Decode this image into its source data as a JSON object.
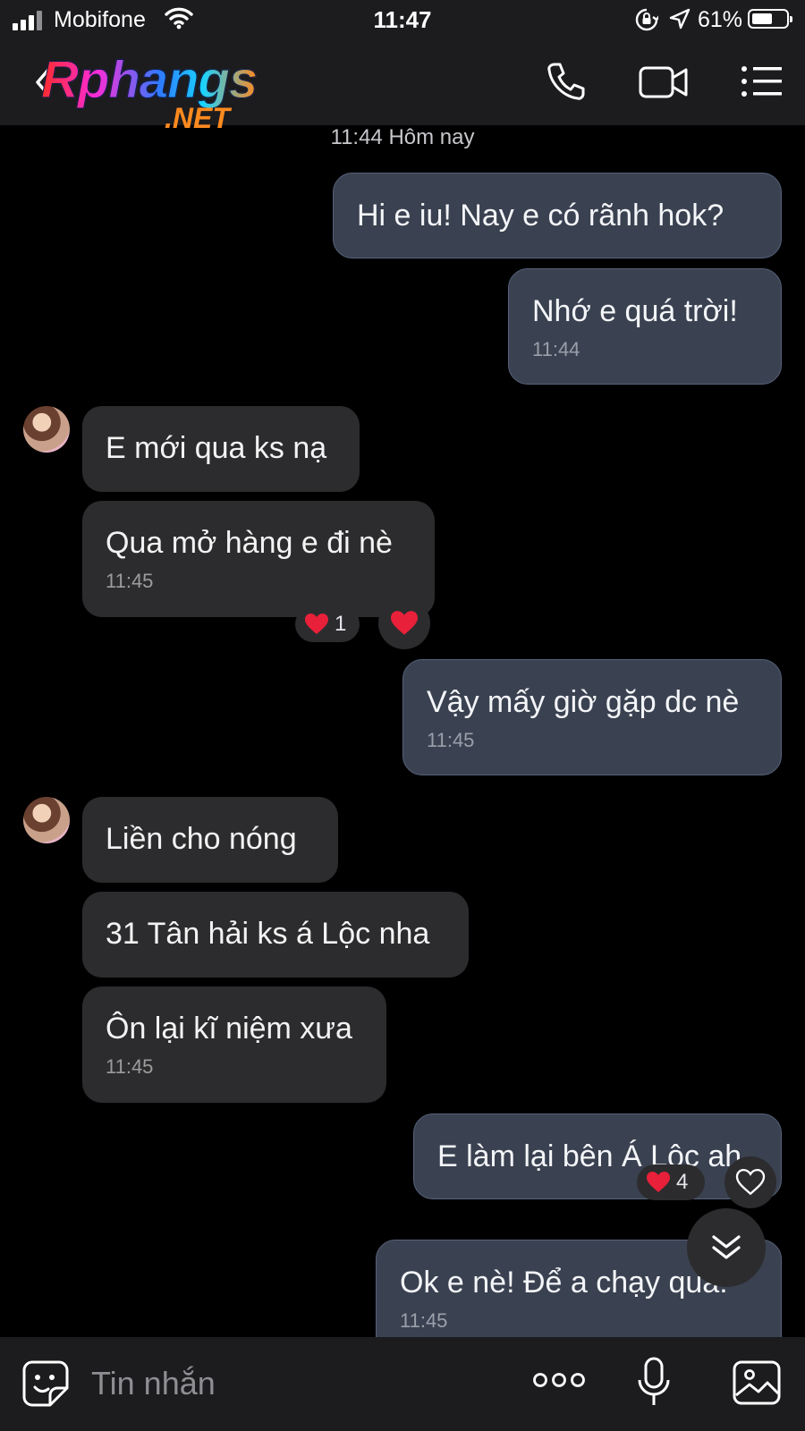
{
  "status_bar": {
    "carrier": "Mobifone",
    "time": "11:47",
    "battery_percent": "61%",
    "battery_level": 0.61,
    "icons": [
      "signal-icon",
      "wifi-icon",
      "orientation-lock-icon",
      "location-icon",
      "battery-icon"
    ]
  },
  "header": {
    "logo_word": "Rphangs",
    "logo_suffix": ".NET",
    "icons": [
      "back-chevron-icon",
      "phone-icon",
      "video-call-icon",
      "menu-list-icon"
    ]
  },
  "chat": {
    "day_stamp": "11:44 Hôm nay",
    "messages": [
      {
        "dir": "out",
        "text": "Hi e iu! Nay e có rãnh hok?",
        "time": ""
      },
      {
        "dir": "out",
        "text": "Nhớ e quá trời!",
        "time": "11:44"
      },
      {
        "dir": "in",
        "text": "E mới qua ks nạ",
        "time": ""
      },
      {
        "dir": "in",
        "text": "Qua mở hàng e đi nè",
        "time": "11:45",
        "reaction_count": "1"
      },
      {
        "dir": "out",
        "text": "Vậy mấy giờ gặp dc nè",
        "time": "11:45"
      },
      {
        "dir": "in",
        "text": "Liền cho nóng",
        "time": ""
      },
      {
        "dir": "in",
        "text": "31 Tân hải ks á Lộc nha",
        "time": ""
      },
      {
        "dir": "in",
        "text": "Ôn lại kĩ niệm xưa",
        "time": "11:45"
      },
      {
        "dir": "out",
        "text": "E làm lại bên Á Lộc ah",
        "time": "",
        "reaction_count": "4"
      },
      {
        "dir": "out",
        "text": "Ok e nè! Để a chạy qua!",
        "time": "11:45"
      }
    ]
  },
  "composer": {
    "placeholder": "Tin nhắn",
    "icons": [
      "sticker-icon",
      "more-options-icon",
      "microphone-icon",
      "image-icon"
    ]
  },
  "colors": {
    "background": "#000000",
    "bar_background": "#1c1c1e",
    "outgoing_bubble": "#3a4150",
    "incoming_bubble": "#2c2c2e",
    "heart": "#e8203a"
  }
}
